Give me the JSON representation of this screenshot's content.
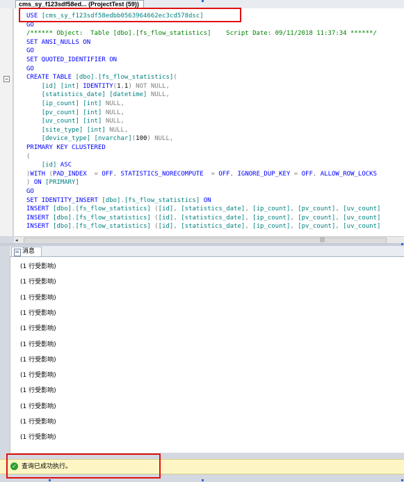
{
  "tab": {
    "title": "cms_sy_f123sdf58ed... (ProjectTest (59))"
  },
  "code_lines": [
    [
      [
        "kw",
        "USE "
      ],
      [
        "tx",
        "[cms_sy_f123sdf58edbb0563964662ec3cd578dsc]"
      ]
    ],
    [
      [
        "kw",
        "GO"
      ]
    ],
    [
      [
        "gn",
        "/****** Object:  Table [dbo].[fs_flow_statistics]    Script Date: 09/11/2018 11:37:34 ******/"
      ]
    ],
    [
      [
        "kw",
        "SET ANSI_NULLS ON"
      ]
    ],
    [
      [
        "kw",
        "GO"
      ]
    ],
    [
      [
        "kw",
        "SET QUOTED_IDENTIFIER ON"
      ]
    ],
    [
      [
        "kw",
        "GO"
      ]
    ],
    [
      [
        "kw",
        "CREATE TABLE "
      ],
      [
        "tx",
        "[dbo]"
      ],
      [
        "gy",
        "."
      ],
      [
        "tx",
        "[fs_flow_statistics]"
      ],
      [
        "gy",
        "("
      ]
    ],
    [
      [
        "bk",
        "    "
      ],
      [
        "tx",
        "[id] [int] "
      ],
      [
        "kw",
        "IDENTITY"
      ],
      [
        "gy",
        "("
      ],
      [
        "bk",
        "1"
      ],
      [
        "gy",
        ","
      ],
      [
        "bk",
        "1"
      ],
      [
        "gy",
        ") NOT NULL,"
      ]
    ],
    [
      [
        "bk",
        "    "
      ],
      [
        "tx",
        "[statistics_date] [datetime] "
      ],
      [
        "gy",
        "NULL,"
      ]
    ],
    [
      [
        "bk",
        "    "
      ],
      [
        "tx",
        "[ip_count] [int] "
      ],
      [
        "gy",
        "NULL,"
      ]
    ],
    [
      [
        "bk",
        "    "
      ],
      [
        "tx",
        "[pv_count] [int] "
      ],
      [
        "gy",
        "NULL,"
      ]
    ],
    [
      [
        "bk",
        "    "
      ],
      [
        "tx",
        "[uv_count] [int] "
      ],
      [
        "gy",
        "NULL,"
      ]
    ],
    [
      [
        "bk",
        "    "
      ],
      [
        "tx",
        "[site_type] [int] "
      ],
      [
        "gy",
        "NULL,"
      ]
    ],
    [
      [
        "bk",
        "    "
      ],
      [
        "tx",
        "[device_type] [nvarchar]"
      ],
      [
        "gy",
        "("
      ],
      [
        "bk",
        "100"
      ],
      [
        "gy",
        ") NULL,"
      ]
    ],
    [
      [
        "kw",
        "PRIMARY KEY CLUSTERED"
      ]
    ],
    [
      [
        "gy",
        "("
      ]
    ],
    [
      [
        "bk",
        "    "
      ],
      [
        "tx",
        "[id] "
      ],
      [
        "kw",
        "ASC"
      ]
    ],
    [
      [
        "gy",
        ")"
      ],
      [
        "kw",
        "WITH "
      ],
      [
        "gy",
        "("
      ],
      [
        "kw",
        "PAD_INDEX  "
      ],
      [
        "gy",
        "= "
      ],
      [
        "kw",
        "OFF"
      ],
      [
        "gy",
        ", "
      ],
      [
        "kw",
        "STATISTICS_NORECOMPUTE  "
      ],
      [
        "gy",
        "= "
      ],
      [
        "kw",
        "OFF"
      ],
      [
        "gy",
        ", "
      ],
      [
        "kw",
        "IGNORE_DUP_KEY "
      ],
      [
        "gy",
        "= "
      ],
      [
        "kw",
        "OFF"
      ],
      [
        "gy",
        ", "
      ],
      [
        "kw",
        "ALLOW_ROW_LOCKS"
      ]
    ],
    [
      [
        "gy",
        ") "
      ],
      [
        "kw",
        "ON "
      ],
      [
        "tx",
        "[PRIMARY]"
      ]
    ],
    [
      [
        "kw",
        "GO"
      ]
    ],
    [
      [
        "kw",
        "SET IDENTITY_INSERT "
      ],
      [
        "tx",
        "[dbo]"
      ],
      [
        "gy",
        "."
      ],
      [
        "tx",
        "[fs_flow_statistics] "
      ],
      [
        "kw",
        "ON"
      ]
    ],
    [
      [
        "kw",
        "INSERT "
      ],
      [
        "tx",
        "[dbo]"
      ],
      [
        "gy",
        "."
      ],
      [
        "tx",
        "[fs_flow_statistics] "
      ],
      [
        "gy",
        "("
      ],
      [
        "tx",
        "[id]"
      ],
      [
        "gy",
        ", "
      ],
      [
        "tx",
        "[statistics_date]"
      ],
      [
        "gy",
        ", "
      ],
      [
        "tx",
        "[ip_count]"
      ],
      [
        "gy",
        ", "
      ],
      [
        "tx",
        "[pv_count]"
      ],
      [
        "gy",
        ", "
      ],
      [
        "tx",
        "[uv_count]"
      ]
    ],
    [
      [
        "kw",
        "INSERT "
      ],
      [
        "tx",
        "[dbo]"
      ],
      [
        "gy",
        "."
      ],
      [
        "tx",
        "[fs_flow_statistics] "
      ],
      [
        "gy",
        "("
      ],
      [
        "tx",
        "[id]"
      ],
      [
        "gy",
        ", "
      ],
      [
        "tx",
        "[statistics_date]"
      ],
      [
        "gy",
        ", "
      ],
      [
        "tx",
        "[ip_count]"
      ],
      [
        "gy",
        ", "
      ],
      [
        "tx",
        "[pv_count]"
      ],
      [
        "gy",
        ", "
      ],
      [
        "tx",
        "[uv_count]"
      ]
    ],
    [
      [
        "kw",
        "INSERT "
      ],
      [
        "tx",
        "[dbo]"
      ],
      [
        "gy",
        "."
      ],
      [
        "tx",
        "[fs_flow_statistics] "
      ],
      [
        "gy",
        "("
      ],
      [
        "tx",
        "[id]"
      ],
      [
        "gy",
        ", "
      ],
      [
        "tx",
        "[statistics_date]"
      ],
      [
        "gy",
        ", "
      ],
      [
        "tx",
        "[ip_count]"
      ],
      [
        "gy",
        ", "
      ],
      [
        "tx",
        "[pv_count]"
      ],
      [
        "gy",
        ", "
      ],
      [
        "tx",
        "[uv_count]"
      ]
    ]
  ],
  "messages_tab": {
    "label": "消息"
  },
  "messages": [
    "(1 行受影响)",
    "(1 行受影响)",
    "(1 行受影响)",
    "(1 行受影响)",
    "(1 行受影响)",
    "(1 行受影响)",
    "(1 行受影响)",
    "(1 行受影响)",
    "(1 行受影响)",
    "(1 行受影响)",
    "(1 行受影响)",
    "(1 行受影响)"
  ],
  "status": {
    "text": "查询已成功执行。",
    "icon": "check-circle-icon",
    "color": "#2e9e2e"
  },
  "highlight_color": "#e01010"
}
